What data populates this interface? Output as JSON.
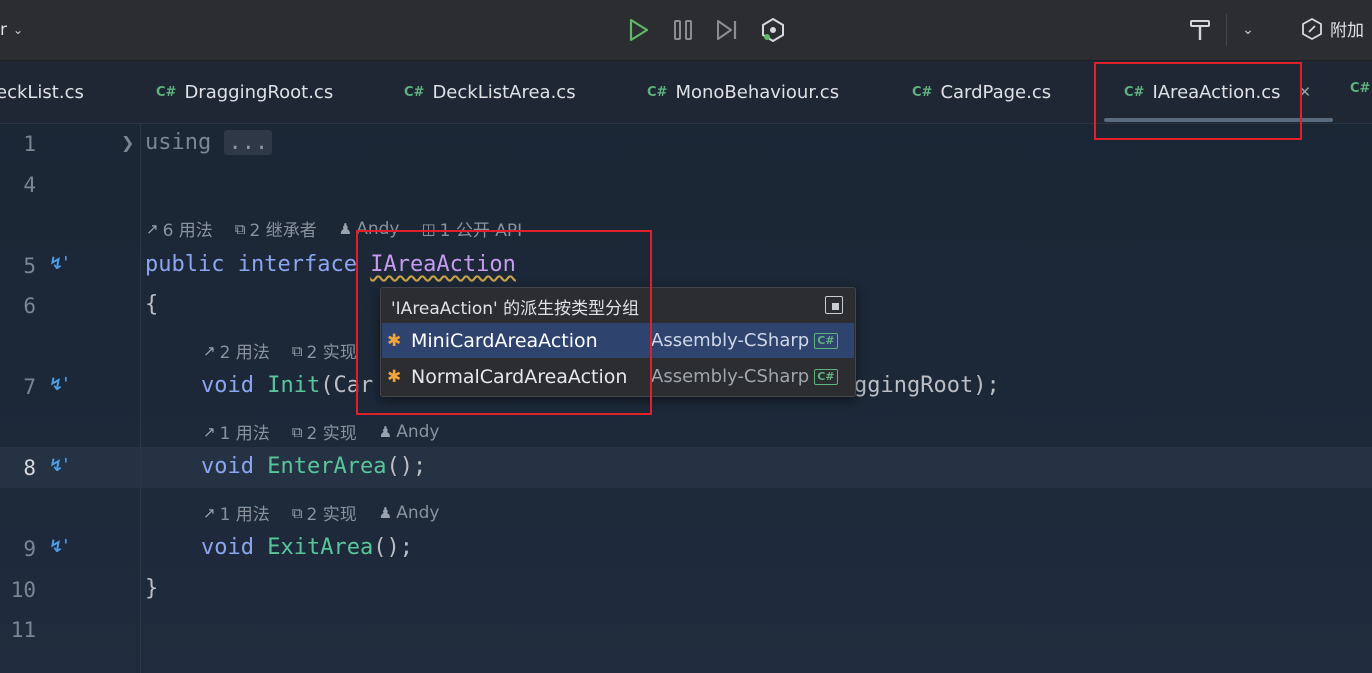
{
  "toolbar": {
    "project_label": "r",
    "attach_label": "附加"
  },
  "tabs": [
    {
      "label": "eckList.cs"
    },
    {
      "label": "DraggingRoot.cs"
    },
    {
      "label": "DeckListArea.cs"
    },
    {
      "label": "MonoBehaviour.cs"
    },
    {
      "label": "CardPage.cs"
    },
    {
      "label": "IAreaAction.cs",
      "active": true
    }
  ],
  "tab_lang_badge": "C#",
  "line_numbers": [
    "1",
    "4",
    "5",
    "6",
    "7",
    "8",
    "9",
    "10",
    "11"
  ],
  "code": {
    "line1_kw": "using",
    "line1_fold": "...",
    "line5_kw1": "public",
    "line5_kw2": "interface",
    "line5_name": "IAreaAction",
    "line6": "{",
    "line7_kw": "void",
    "line7_method": "Init",
    "line7_before": "(Car",
    "line7_after": "ggingRoot);",
    "line8_kw": "void",
    "line8_method": "EnterArea",
    "line8_rest": "();",
    "line9_kw": "void",
    "line9_method": "ExitArea",
    "line9_rest": "();",
    "line10": "}"
  },
  "hints": {
    "iface": {
      "usages": "6 用法",
      "inheritors": "2 继承者",
      "author": "Andy",
      "api": "1 公开 API"
    },
    "init": {
      "usages": "2 用法",
      "impl": "2 实现"
    },
    "enter": {
      "usages": "1 用法",
      "impl": "2 实现",
      "author": "Andy"
    },
    "exit": {
      "usages": "1 用法",
      "impl": "2 实现",
      "author": "Andy"
    }
  },
  "popup": {
    "title": "'IAreaAction' 的派生按类型分组",
    "rows": [
      {
        "name": "MiniCardAreaAction",
        "assembly": "Assembly-CSharp",
        "badge": "C#",
        "selected": true
      },
      {
        "name": "NormalCardAreaAction",
        "assembly": "Assembly-CSharp",
        "badge": "C#",
        "selected": false
      }
    ]
  },
  "colors": {
    "highlight_box": "#e0202a",
    "keyword": "#8ca5f0",
    "interface_name": "#c79bf0",
    "method": "#59c59a",
    "selected_row": "#2e436e"
  }
}
